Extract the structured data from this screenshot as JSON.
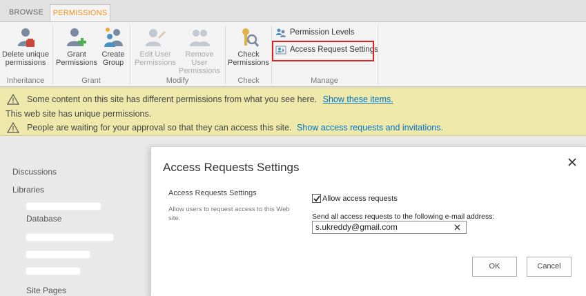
{
  "ribbon": {
    "tabs": [
      {
        "label": "BROWSE"
      },
      {
        "label": "PERMISSIONS"
      }
    ],
    "groups": {
      "inheritance": {
        "label": "Inheritance",
        "delete_unique": {
          "line1": "Delete unique",
          "line2": "permissions"
        }
      },
      "grant": {
        "label": "Grant",
        "grant_permissions": {
          "line1": "Grant",
          "line2": "Permissions"
        },
        "create_group": {
          "line1": "Create",
          "line2": "Group"
        }
      },
      "modify": {
        "label": "Modify",
        "edit_user": {
          "line1": "Edit User",
          "line2": "Permissions"
        },
        "remove_user": {
          "line1": "Remove User",
          "line2": "Permissions"
        }
      },
      "check": {
        "label": "Check",
        "check_permissions": {
          "line1": "Check",
          "line2": "Permissions"
        }
      },
      "manage": {
        "label": "Manage",
        "permission_levels": "Permission Levels",
        "access_request_settings": "Access Request Settings"
      }
    }
  },
  "status": {
    "line1_text": "Some content on this site has different permissions from what you see here.",
    "line1_link": "Show these items.",
    "line2_text": "This web site has unique permissions.",
    "line3_text": "People are waiting for your approval so that they can access this site.",
    "line3_link": "Show access requests and invitations."
  },
  "leftnav": {
    "discussions": "Discussions",
    "libraries": "Libraries",
    "database": "Database",
    "site_pages": "Site Pages"
  },
  "dialog": {
    "title": "Access Requests Settings",
    "section_title": "Access Requests Settings",
    "section_desc": "Allow users to request access to this Web site.",
    "allow_label": "Allow access requests",
    "allow_checked": true,
    "email_label": "Send all access requests to the following e-mail address:",
    "email_value": "s.ukreddy@gmail.com",
    "ok_label": "OK",
    "cancel_label": "Cancel"
  },
  "colors": {
    "active_tab": "#f18f1e",
    "status_bg": "#eee8aa",
    "link": "#0072c6",
    "highlight": "#e02020"
  }
}
